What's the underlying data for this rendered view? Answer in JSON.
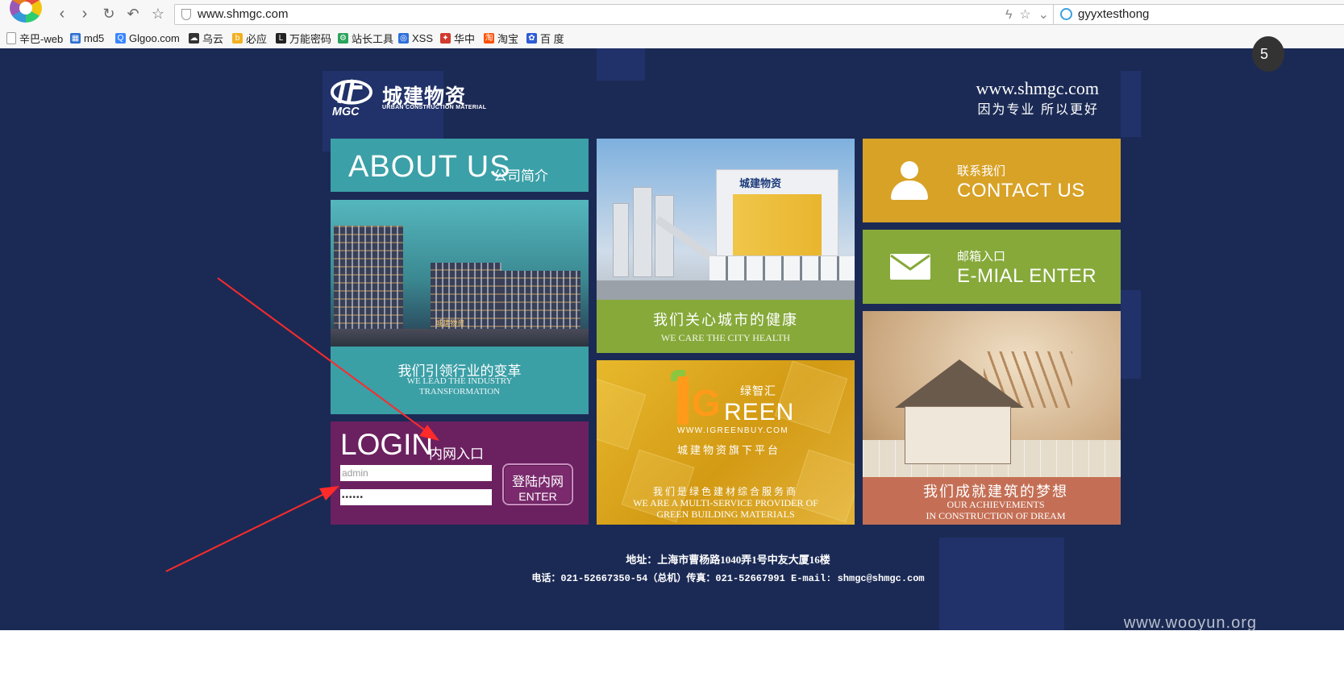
{
  "browser": {
    "url": "www.shmgc.com",
    "search_query": "gyyxtesthong",
    "ext_badge": "5",
    "nav_icons": [
      "back-icon",
      "forward-icon",
      "reload-icon",
      "undo-icon",
      "star-icon"
    ]
  },
  "bookmarks": [
    {
      "label": "辛巴-web",
      "icon": "page-icon",
      "color": "#888888"
    },
    {
      "label": "md5",
      "icon": "grid-icon",
      "color": "#2c6fd1"
    },
    {
      "label": "Glgoo.com",
      "icon": "search-icon",
      "color": "#3a86ff"
    },
    {
      "label": "乌云",
      "icon": "cloud-icon",
      "color": "#333333"
    },
    {
      "label": "必应",
      "icon": "bing-icon",
      "color": "#f2b01e"
    },
    {
      "label": "万能密码",
      "icon": "l-icon",
      "color": "#222222"
    },
    {
      "label": "站长工具",
      "icon": "tool-icon",
      "color": "#2aa35b"
    },
    {
      "label": "XSS",
      "icon": "globe-icon",
      "color": "#2f6fdb"
    },
    {
      "label": "华中",
      "icon": "bird-icon",
      "color": "#d03b2f"
    },
    {
      "label": "淘宝",
      "icon": "taobao-icon",
      "color": "#ff5000"
    },
    {
      "label": "百 度",
      "icon": "paw-icon",
      "color": "#2e5bd6"
    }
  ],
  "header": {
    "brand_cn": "城建物资",
    "brand_en": "URBAN CONSTRUCTION MATERIAL",
    "brand_mark": "MGC",
    "site_url": "www.shmgc.com",
    "slogan": "因为专业  所以更好"
  },
  "about": {
    "en": "ABOUT US",
    "cn": "公司简介"
  },
  "lead": {
    "building_sign": "城建物资",
    "cn": "我们引领行业的变革",
    "en_line1": "WE LEAD THE INDUSTRY",
    "en_line2": "TRANSFORMATION"
  },
  "login": {
    "title_en": "LOGIN",
    "title_cn": "内网入口",
    "username_value": "admin",
    "password_value": "••••••",
    "button_cn": "登陆内网",
    "button_en": "ENTER"
  },
  "factory": {
    "sign": "城建物资",
    "cn": "我们关心城市的健康",
    "en": "WE CARE THE CITY HEALTH"
  },
  "green": {
    "brand_cn": "绿智汇",
    "brand_reen": "REEN",
    "url": "WWW.IGREENBUY.COM",
    "tagline": "城建物资旗下平台",
    "cn": "我们是绿色建材综合服务商",
    "en_line1": "WE ARE A MULTI-SERVICE PROVIDER OF",
    "en_line2": "GREEN BUILDING MATERIALS"
  },
  "contact": {
    "cn": "联系我们",
    "en": "CONTACT US"
  },
  "email": {
    "cn": "邮箱入口",
    "en": "E-MIAL ENTER"
  },
  "dream": {
    "cn": "我们成就建筑的梦想",
    "en_line1": "OUR ACHIEVEMENTS",
    "en_line2": "IN CONSTRUCTION OF DREAM"
  },
  "footer": {
    "address": "地址：上海市曹杨路1040弄1号中友大厦16楼",
    "contact": "电话：021-52667350-54（总机）传真：021-52667991 E-mail: shmgc@shmgc.com"
  },
  "watermark": "www.wooyun.org",
  "colors": {
    "site_bg": "#1b2a55",
    "teal": "#3ba0a7",
    "purple": "#6b2160",
    "green": "#86a93a",
    "gold": "#d8a227",
    "terracotta": "#c46f55",
    "annotation_arrow": "#ff2a2a"
  }
}
